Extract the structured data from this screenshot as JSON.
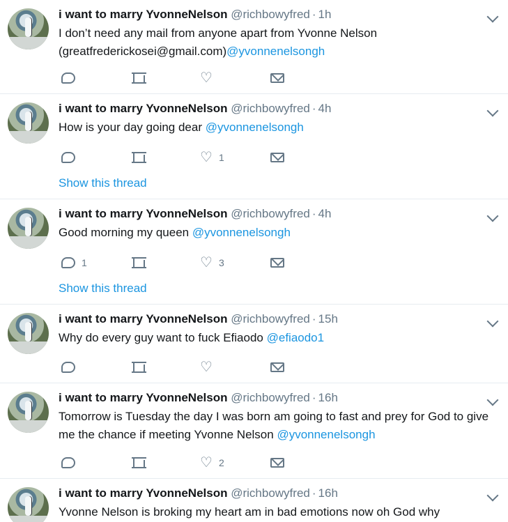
{
  "tweets": [
    {
      "name": "i want to marry YvonneNelson",
      "handle": "@richbowyfred",
      "time": "1h",
      "text_before": "I don’t need any mail from anyone apart from Yvonne Nelson (greatfrederickosei@gmail.com)",
      "mention": "@yvonnenelsongh",
      "text_after": "",
      "reply_count": "",
      "like_count": "",
      "show_thread": ""
    },
    {
      "name": "i want to marry YvonneNelson",
      "handle": "@richbowyfred",
      "time": "4h",
      "text_before": "How is your day going dear ",
      "mention": "@yvonnenelsongh",
      "text_after": "",
      "reply_count": "",
      "like_count": "1",
      "show_thread": "Show this thread"
    },
    {
      "name": "i want to marry YvonneNelson",
      "handle": "@richbowyfred",
      "time": "4h",
      "text_before": "Good morning my queen ",
      "mention": "@yvonnenelsongh",
      "text_after": "",
      "reply_count": "1",
      "like_count": "3",
      "show_thread": "Show this thread"
    },
    {
      "name": "i want to marry YvonneNelson",
      "handle": "@richbowyfred",
      "time": "15h",
      "text_before": "Why do every guy want to fuck Efiaodo ",
      "mention": "@efiaodo1",
      "text_after": "",
      "reply_count": "",
      "like_count": "",
      "show_thread": ""
    },
    {
      "name": "i want to marry YvonneNelson",
      "handle": "@richbowyfred",
      "time": "16h",
      "text_before": "Tomorrow is Tuesday the day I was born am going to fast and prey for God to give me the chance if meeting Yvonne Nelson ",
      "mention": "@yvonnenelsongh",
      "text_after": "",
      "reply_count": "",
      "like_count": "2",
      "show_thread": ""
    },
    {
      "name": "i want to marry YvonneNelson",
      "handle": "@richbowyfred",
      "time": "16h",
      "text_before": "Yvonne Nelson is broking my heart am in bad emotions now oh God why",
      "mention": "",
      "text_after": "",
      "reply_count": "",
      "like_count": "",
      "show_thread": ""
    }
  ],
  "icons": {
    "reply": "reply-icon",
    "retweet": "retweet-icon",
    "like": "heart-icon",
    "message": "direct-message-icon",
    "more": "chevron-down-icon"
  },
  "colors": {
    "link": "#1b95e0",
    "muted": "#657786",
    "text": "#14171a",
    "divider": "#e6ecf0"
  }
}
